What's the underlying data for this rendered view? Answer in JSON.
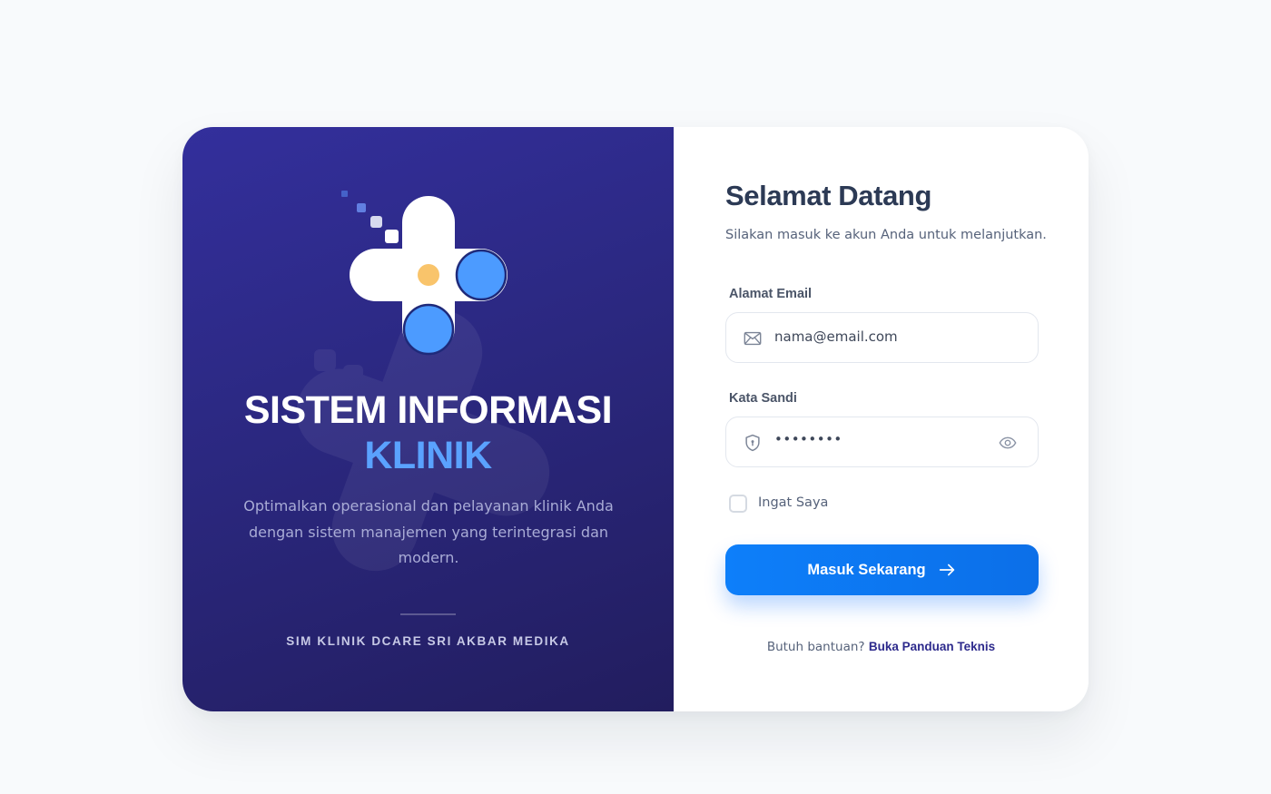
{
  "brand": {
    "title": "SISTEM INFORMASI",
    "accent": "KLINIK",
    "description": "Optimalkan operasional dan pelayanan klinik Anda dengan sistem manajemen yang terintegrasi dan modern.",
    "footer": "SIM KLINIK DCARE SRI AKBAR MEDIKA",
    "logo_icon": "medical-cross-logo"
  },
  "login": {
    "heading": "Selamat Datang",
    "subtitle": "Silakan masuk ke akun Anda untuk melanjutkan.",
    "email": {
      "label": "Alamat Email",
      "value": "nama@email.com",
      "icon": "mail-icon"
    },
    "password": {
      "label": "Kata Sandi",
      "value": "••••••••",
      "icon": "shield-lock-icon",
      "toggle_icon": "eye-icon"
    },
    "remember": {
      "label": "Ingat Saya",
      "checked": false
    },
    "submit": {
      "label": "Masuk Sekarang",
      "icon": "arrow-right-icon"
    },
    "help": {
      "text": "Butuh bantuan?",
      "link": "Buka Panduan Teknis"
    }
  },
  "colors": {
    "panel_start": "#332f9c",
    "panel_end": "#221d5e",
    "accent": "#5aa2ff",
    "primary_button": "#0d7ffa",
    "link": "#2d2a8c",
    "heading": "#2c3a55",
    "logo_dot": "#f9c46b"
  }
}
